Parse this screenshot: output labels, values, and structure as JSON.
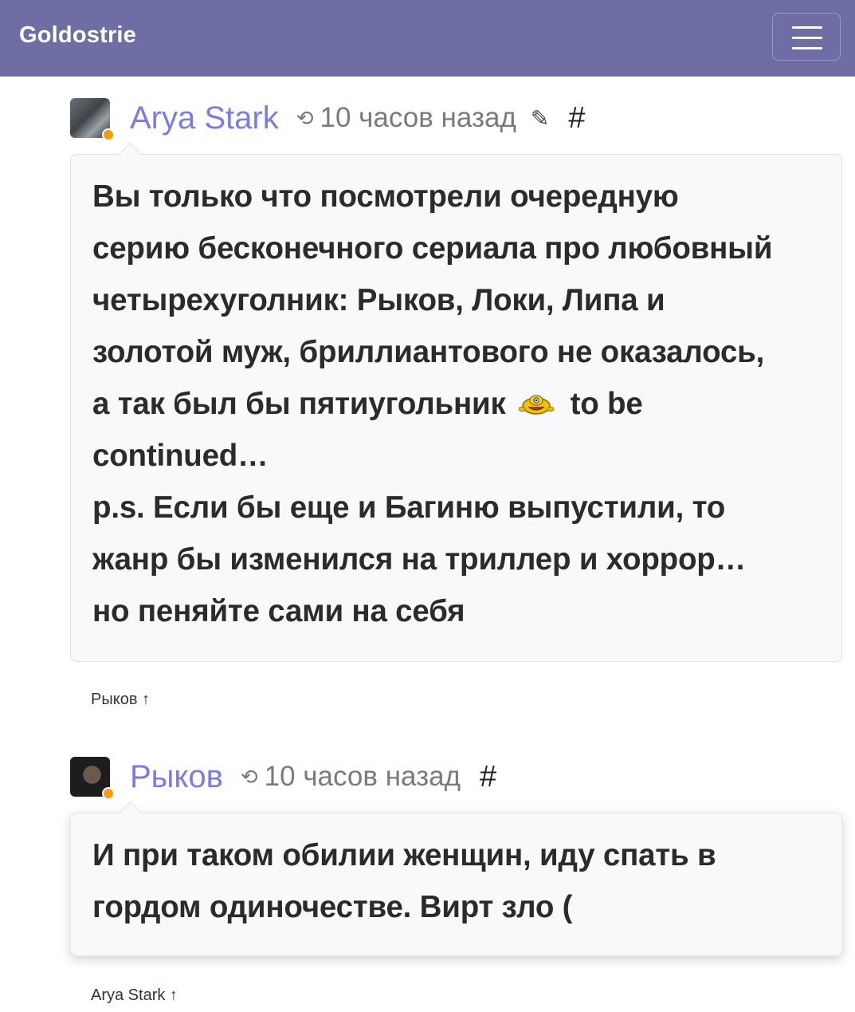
{
  "navbar": {
    "brand": "Goldostrie",
    "menu_icon": "hamburger-menu-icon"
  },
  "posts": [
    {
      "author": "Arya Stark",
      "history_icon": "history-icon",
      "time": "10 часов назад",
      "edit_icon": "pencil-icon",
      "anchor": "#",
      "lines": [
        "Вы только что посмотрели очередную",
        "серию бесконечного сериала про любовный",
        "четырехуголник: Рыков, Локи, Липа и",
        "золотой муж, бриллиантового не оказалось,",
        "а так был бы пятиугольник",
        "to be",
        "continued…",
        "p.s. Если бы еще и Багиню выпустили, то",
        "жанр бы изменился на триллер и хоррор…",
        "но пеняйте сами на себя"
      ],
      "emoji": "laughing-smiley-icon",
      "reply_to": "Рыков ↑"
    },
    {
      "author": "Рыков",
      "history_icon": "history-icon",
      "time": "10 часов назад",
      "anchor": "#",
      "lines": [
        "И при таком обилии женщин, иду спать в",
        "гордом одиночестве. Вирт зло ("
      ],
      "reply_to": "Arya Stark ↑"
    }
  ]
}
